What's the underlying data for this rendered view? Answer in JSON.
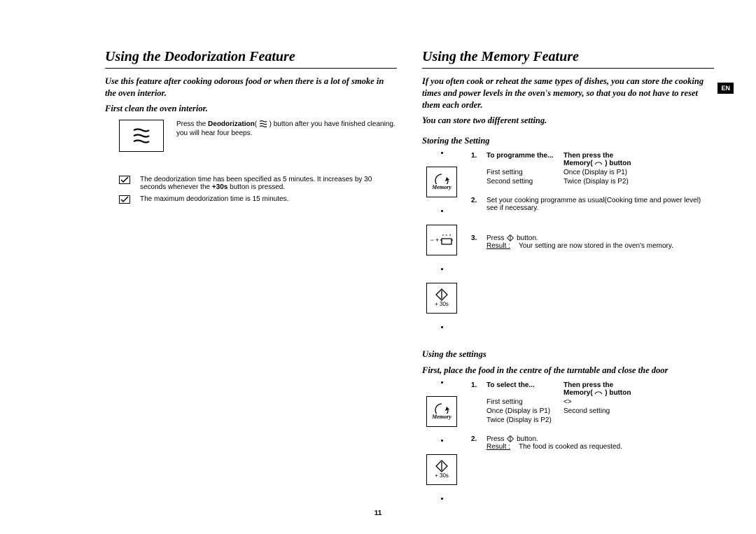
{
  "lang_tab": "EN",
  "page_number": "11",
  "left": {
    "title": "Using the Deodorization Feature",
    "intro": "Use this feature after cooking odorous food or when there is a lot of smoke in the oven interior.",
    "sub": "First clean the oven interior.",
    "step_text_a": "Press the ",
    "step_text_b": "Deodorization",
    "step_text_c": "( ",
    "step_text_d": " ) button after you have finished cleaning. you will hear four beeps.",
    "note1_a": "The deodorization time has been specified as 5 minutes. It increases by 30 seconds whenever the ",
    "note1_b": "+30s",
    "note1_c": " button is pressed.",
    "note2": "The maximum deodorization time is 15 minutes."
  },
  "right": {
    "title": "Using the Memory Feature",
    "intro": "If you often cook or reheat the same types of dishes, you can store the cooking times and power levels in the oven's memory, so that you do not have to reset them each order.",
    "sub": "You can store two different setting.",
    "storing_heading": "Storing the Setting",
    "step1_num": "1.",
    "step1_hd_left": "To programme the...",
    "step1_hd_right_a": "Then press the",
    "step1_hd_right_b": "Memory( ",
    "step1_hd_right_c": " ) button",
    "first_setting": "First setting",
    "first_setting_val": "Once (Display is P1)",
    "second_setting": "Second setting",
    "second_setting_val": "Twice (Display is P2)",
    "step2_num": "2.",
    "step2_text": "Set your cooking programme as usual(Cooking time and power level) see if necessary.",
    "step3_num": "3.",
    "step3_text_a": "Press ",
    "step3_text_b": " button.",
    "step3_result_label": "Result :",
    "step3_result_text": "Your setting are now stored in the oven's memory.",
    "using_heading": "Using the settings",
    "using_sub": "First, place the food in the centre of the turntable and close the door",
    "u_step1_num": "1.",
    "u_step1_hd_left": "To select the...",
    "u_step1_hd_right_a": "Then press the",
    "u_step1_hd_right_b": "Memory( ",
    "u_step1_hd_right_c": " ) button",
    "u_step2_num": "2.",
    "u_step2_text_a": "Press ",
    "u_step2_text_b": " button.",
    "u_step2_result_label": "Result :",
    "u_step2_result_text": "The food is cooked as requested.",
    "plus30s": "+ 30s",
    "memory_label": "Memory"
  }
}
